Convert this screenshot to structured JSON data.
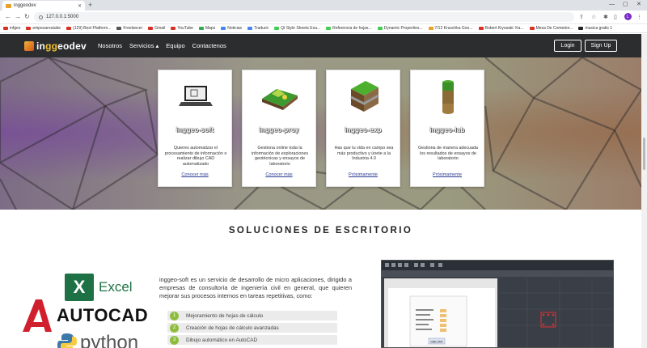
{
  "browser": {
    "tab_title": "inggeodev",
    "url": "127.0.0.1:5000",
    "bookmarks": [
      {
        "label": "infges",
        "color": "#d93025"
      },
      {
        "label": "empezaroutube",
        "color": "#d93025"
      },
      {
        "label": "(129) Best Platform...",
        "color": "#d93025"
      },
      {
        "label": "Freelancer",
        "color": "#555555"
      },
      {
        "label": "Gmail",
        "color": "#d93025"
      },
      {
        "label": "YouTube",
        "color": "#d93025"
      },
      {
        "label": "Maps",
        "color": "#34a853"
      },
      {
        "label": "Noticias",
        "color": "#4285f4"
      },
      {
        "label": "Traducir",
        "color": "#4285f4"
      },
      {
        "label": "Qt Style Sheets Exa...",
        "color": "#41cd52"
      },
      {
        "label": "Referencia de hojas...",
        "color": "#41cd52"
      },
      {
        "label": "Dynamic Properties...",
        "color": "#41cd52"
      },
      {
        "label": "7/12 Kruschka Goo...",
        "color": "#e9a12b"
      },
      {
        "label": "Robert Kiyosaki: Ka...",
        "color": "#d93025"
      },
      {
        "label": "Mesa De Comedor...",
        "color": "#d93025"
      },
      {
        "label": "musica gratis 1",
        "color": "#222222"
      }
    ],
    "avatar_letter": "L"
  },
  "site": {
    "logo_pre": "in",
    "logo_g": "gg",
    "logo_post": "eodev",
    "menu": {
      "nosotros": "Nosotros",
      "servicios": "Servicios ▴",
      "equipo": "Equipo",
      "contactenos": "Contactenos"
    },
    "login": "Login",
    "signup": "Sign Up"
  },
  "cards": [
    {
      "name": "inggeo-soft",
      "desc": "Quieres automatizar el procesamiento de información o realizar dibujo CAD automatizado",
      "link": "Conocer más"
    },
    {
      "name": "inggeo-proy",
      "desc": "Gestiona online toda la información de exploraciones geotécnicas y ensayos de laboratorio",
      "link": "Conocer más"
    },
    {
      "name": "inggeo-exp",
      "desc": "Has que tu vida en campo sea más productivo y únete a la Industria 4.0",
      "link": "Próximamente"
    },
    {
      "name": "inggeo-lab",
      "desc": "Gestiona de manera adecuada los resultados de ensayos de laboratorio",
      "link": "Próximamente"
    }
  ],
  "desktop": {
    "title": "SOLUCIONES DE ESCRITORIO",
    "excel_label": "Excel",
    "excel_letter": "X",
    "autocad_label": "AUTOCAD",
    "python_label": "python",
    "paragraph": "inggeo-soft es un servicio de desarrollo de micro aplicaciones, dirigido a empresas de consultoría de ingeniería civil en general, que quieren mejorar sus procesos internos en tareas repetitivas, como:",
    "features": [
      {
        "num": "1",
        "text": "Mejoramiento de hojas de cálculo"
      },
      {
        "num": "2",
        "text": "Creación de hojas de cálculo avanzadas"
      },
      {
        "num": "3",
        "text": "Dibujo automático en AutoCAD"
      }
    ],
    "screenshot_button": "DIBUJAR"
  },
  "colors": {
    "nav_bg": "#2c2d2f",
    "accent_green": "#8fbc3f",
    "link_blue": "#2a3a8f",
    "logo_yellow": "#f2c12e"
  }
}
